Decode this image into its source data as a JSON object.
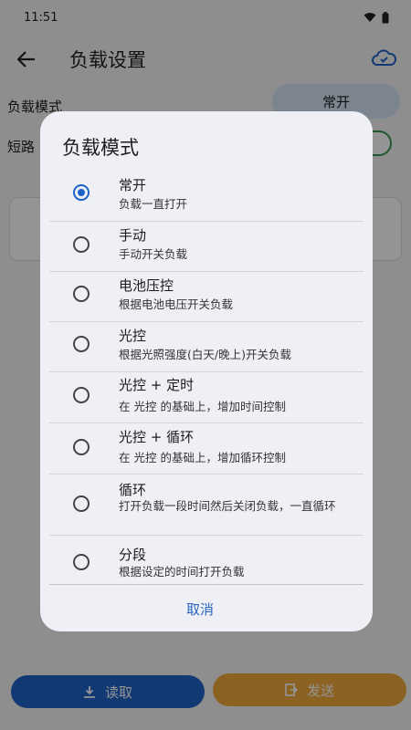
{
  "status": {
    "time": "11:51"
  },
  "app_bar": {
    "title": "负载设置"
  },
  "screen": {
    "mode_label": "负载模式",
    "mode_value": "常开",
    "short_label": "短路"
  },
  "bottom": {
    "read_label": "读取",
    "send_label": "发送"
  },
  "dialog": {
    "title": "负载模式",
    "cancel_label": "取消",
    "options": [
      {
        "title": "常开",
        "desc": "负载一直打开",
        "selected": true
      },
      {
        "title": "手动",
        "desc": "手动开关负载",
        "selected": false
      },
      {
        "title": "电池压控",
        "desc": "根据电池电压开关负载",
        "selected": false
      },
      {
        "title": "光控",
        "desc": "根据光照强度(白天/晚上)开关负载",
        "selected": false
      },
      {
        "title": "光控 + 定时",
        "desc": "在 光控 的基础上，增加时间控制",
        "selected": false
      },
      {
        "title": "光控 + 循环",
        "desc": "在 光控 的基础上，增加循环控制",
        "selected": false
      },
      {
        "title": "循环",
        "desc": "打开负载一段时间然后关闭负载，一直循环",
        "selected": false
      },
      {
        "title": "分段",
        "desc": "根据设定的时间打开负载",
        "selected": false
      }
    ]
  },
  "colors": {
    "accent": "#1e62c8",
    "send": "#f0a93c",
    "toggle": "#3a9a50"
  }
}
